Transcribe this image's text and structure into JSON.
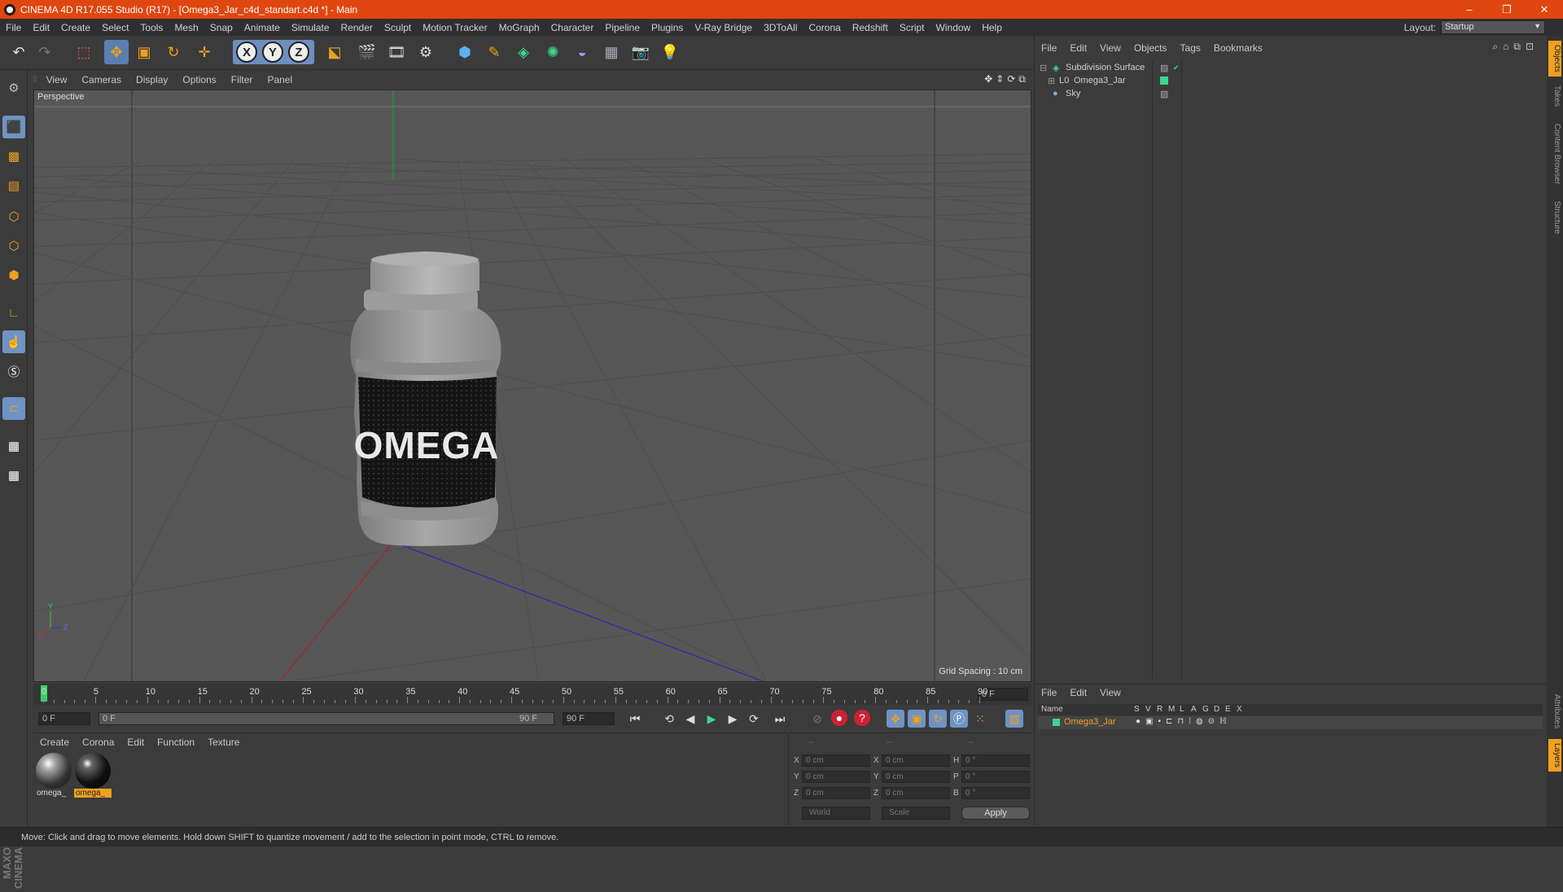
{
  "window": {
    "title": "CINEMA 4D R17.055 Studio (R17) - [Omega3_Jar_c4d_standart.c4d *] - Main",
    "controls": {
      "minimize": "–",
      "restore": "❐",
      "close": "✕"
    }
  },
  "menubar": {
    "items": [
      "File",
      "Edit",
      "Create",
      "Select",
      "Tools",
      "Mesh",
      "Snap",
      "Animate",
      "Simulate",
      "Render",
      "Sculpt",
      "Motion Tracker",
      "MoGraph",
      "Character",
      "Pipeline",
      "Plugins",
      "V-Ray Bridge",
      "3DToAll",
      "Corona",
      "Redshift",
      "Script",
      "Window",
      "Help"
    ],
    "layout_label": "Layout:",
    "layout_value": "Startup"
  },
  "viewport": {
    "menu": [
      "View",
      "Cameras",
      "Display",
      "Options",
      "Filter",
      "Panel"
    ],
    "camera_label": "Perspective",
    "grid_spacing": "Grid Spacing : 10 cm",
    "object_text": "OMEGA",
    "axis_labels": {
      "y": "Y",
      "x": "X",
      "z": "Z"
    }
  },
  "object_manager": {
    "menu": [
      "File",
      "Edit",
      "View",
      "Objects",
      "Tags",
      "Bookmarks"
    ],
    "objects": [
      {
        "name": "Subdivision Surface",
        "icon": "subdivision-icon"
      },
      {
        "name": "Omega3_Jar",
        "icon": "polygon-object-icon"
      },
      {
        "name": "Sky",
        "icon": "sky-icon"
      }
    ]
  },
  "side_tabs": [
    "Objects",
    "Takes",
    "Content Browser",
    "Structure"
  ],
  "side_tabs_bottom": [
    "Attributes",
    "Layers"
  ],
  "timeline": {
    "ticks": [
      "0",
      "5",
      "10",
      "15",
      "20",
      "25",
      "30",
      "35",
      "40",
      "45",
      "50",
      "55",
      "60",
      "65",
      "70",
      "75",
      "80",
      "85",
      "90"
    ],
    "current_frame": "0 F",
    "start_frame": "0 F",
    "range_start": "0 F",
    "range_end": "90 F",
    "end_frame": "90 F"
  },
  "material_manager": {
    "menu": [
      "Create",
      "Corona",
      "Edit",
      "Function",
      "Texture"
    ],
    "materials": [
      {
        "label": "omega_",
        "selected": false
      },
      {
        "label": "omega_",
        "selected": true
      }
    ]
  },
  "coordinates": {
    "headers": [
      "--",
      "--",
      "--"
    ],
    "rows": [
      {
        "axis": "X",
        "pos": "0 cm",
        "size_axis": "X",
        "size": "0 cm",
        "rot_axis": "H",
        "rot": "0 °"
      },
      {
        "axis": "Y",
        "pos": "0 cm",
        "size_axis": "Y",
        "size": "0 cm",
        "rot_axis": "P",
        "rot": "0 °"
      },
      {
        "axis": "Z",
        "pos": "0 cm",
        "size_axis": "Z",
        "size": "0 cm",
        "rot_axis": "B",
        "rot": "0 °"
      }
    ],
    "space": "World",
    "mode": "Scale",
    "apply": "Apply"
  },
  "layer_manager": {
    "menu": [
      "File",
      "Edit",
      "View"
    ],
    "columns": [
      "Name",
      "S",
      "V",
      "R",
      "M",
      "L",
      "A",
      "G",
      "D",
      "E",
      "X"
    ],
    "layer": "Omega3_Jar"
  },
  "status": "Move: Click and drag to move elements. Hold down SHIFT to quantize movement / add to the selection in point mode, CTRL to remove.",
  "colors": {
    "title_bar": "#e0460f",
    "accent": "#f0a020",
    "selection": "#6f93c4",
    "layer_color": "#3dd68c"
  }
}
